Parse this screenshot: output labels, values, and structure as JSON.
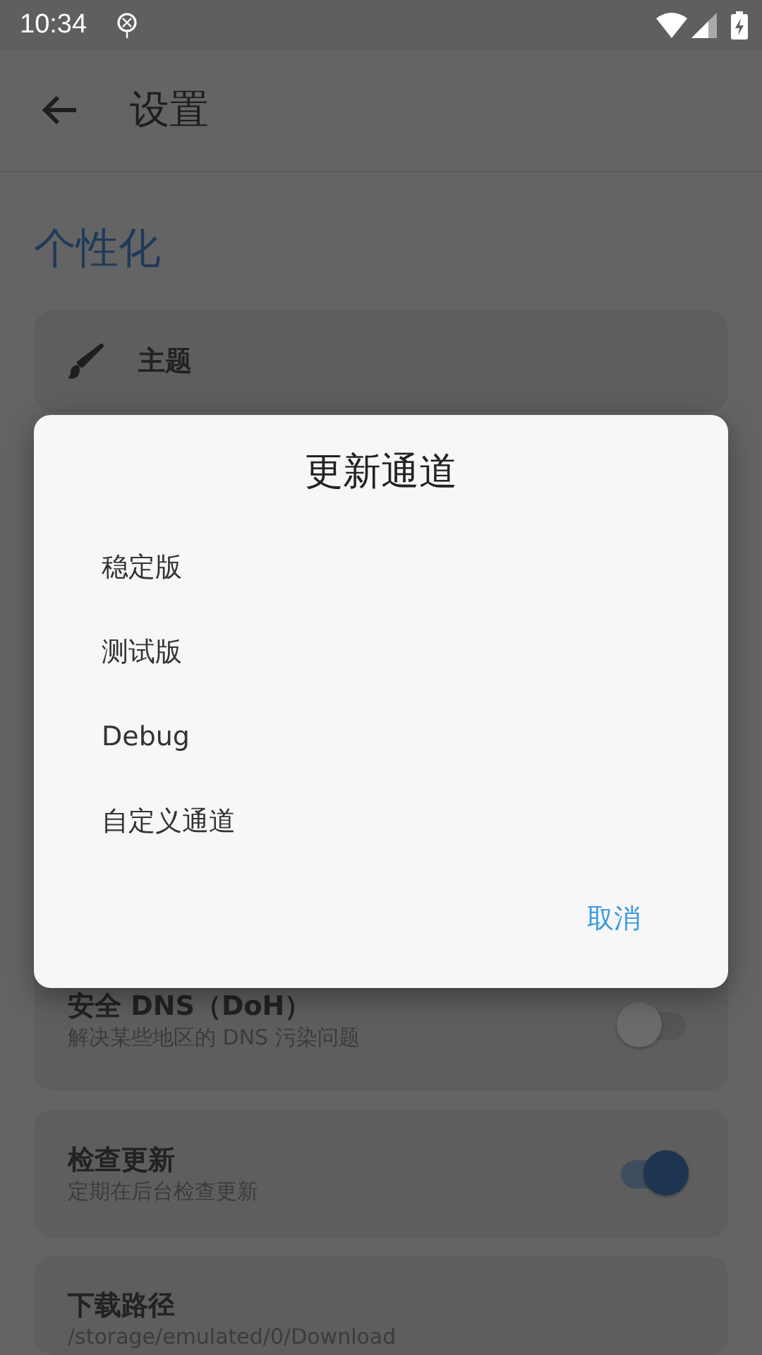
{
  "status_bar": {
    "time": "10:34"
  },
  "app_bar": {
    "title": "设置"
  },
  "section_title": "个性化",
  "settings": [
    {
      "kind": "icon",
      "title": "主题"
    },
    {
      "kind": "switch",
      "title": "安全 DNS（DoH）",
      "subtitle": "解决某些地区的 DNS 污染问题",
      "on": false
    },
    {
      "kind": "switch",
      "title": "检查更新",
      "subtitle": "定期在后台检查更新",
      "on": true
    },
    {
      "kind": "text",
      "title": "下载路径",
      "subtitle": "/storage/emulated/0/Download"
    }
  ],
  "dialog": {
    "title": "更新通道",
    "options": [
      "稳定版",
      "测试版",
      "Debug",
      "自定义通道"
    ],
    "cancel": "取消"
  }
}
